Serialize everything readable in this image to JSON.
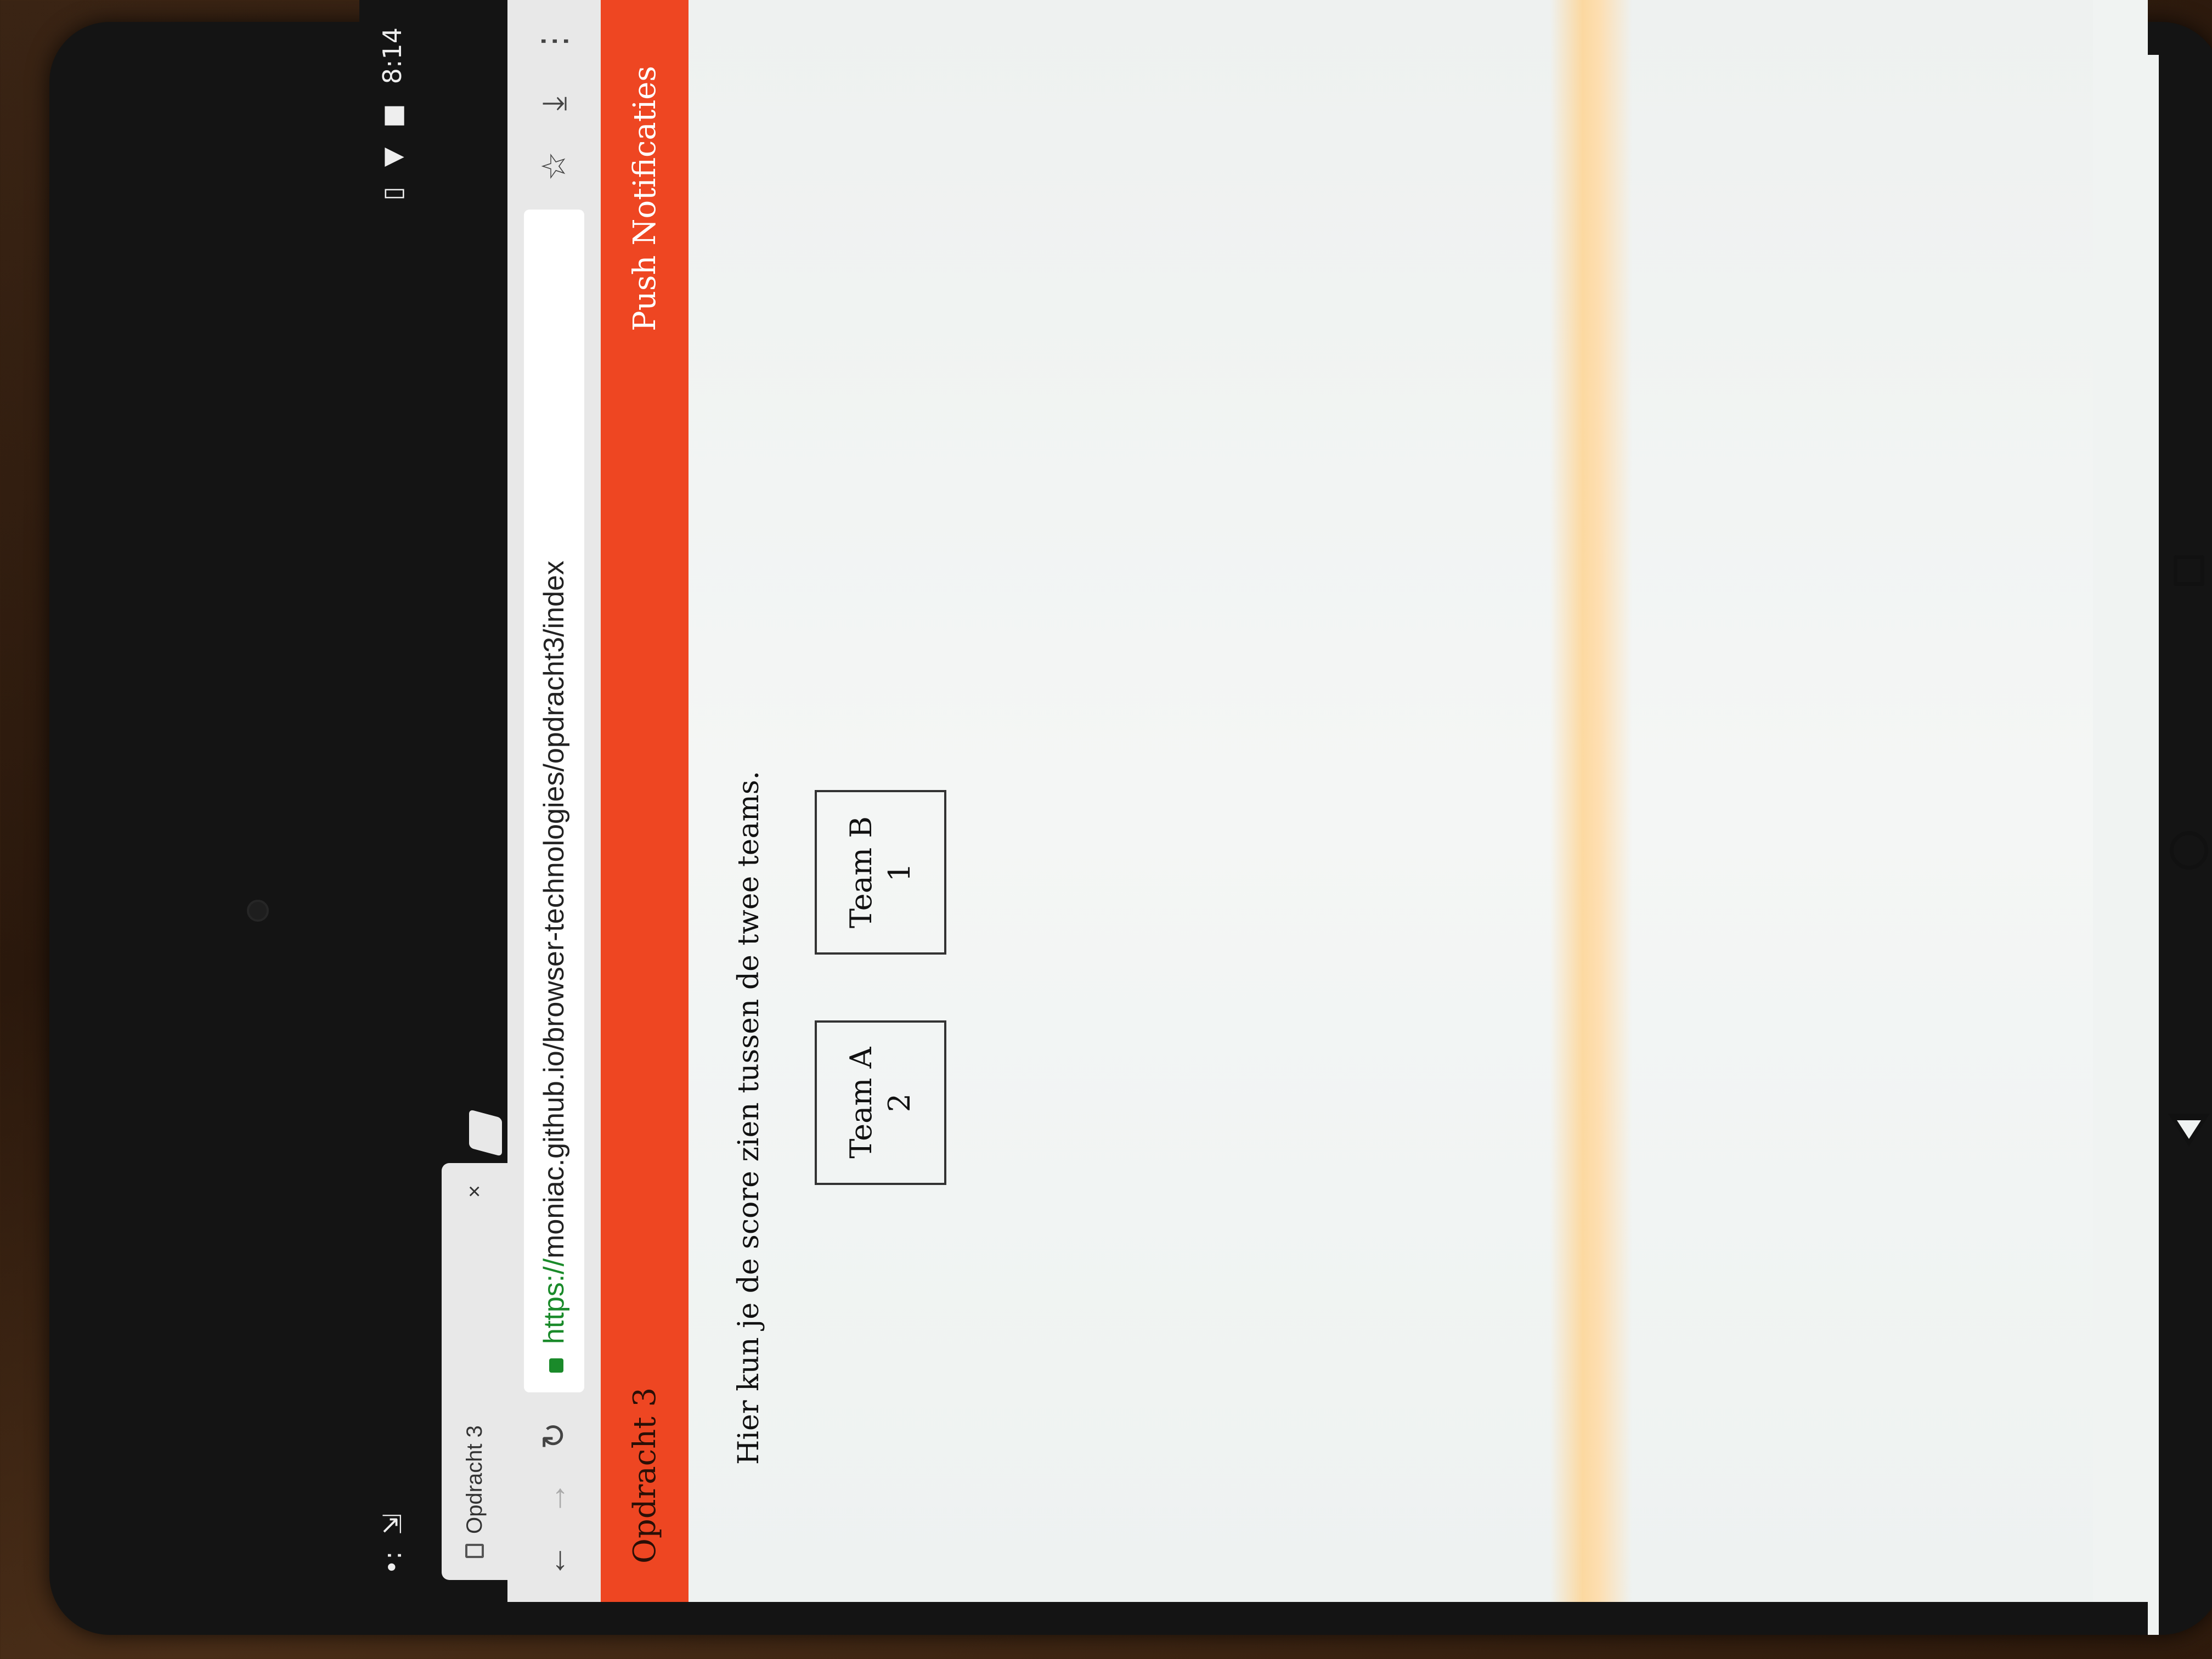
{
  "statusbar": {
    "time": "8:14"
  },
  "browser": {
    "tab_title": "Opdracht 3",
    "tab_close": "×",
    "url_scheme": "https://",
    "url_rest": "moniac.github.io/browser-technologies/opdracht3/index"
  },
  "app": {
    "brand": "Opdracht 3",
    "nav_link": "Push Notificaties"
  },
  "content": {
    "intro": "Hier kun je de score zien tussen de twee teams.",
    "teams": [
      {
        "name": "Team A",
        "score": "2"
      },
      {
        "name": "Team B",
        "score": "1"
      }
    ]
  },
  "colors": {
    "accent": "#ee4622",
    "secure": "#1a8a2a"
  }
}
